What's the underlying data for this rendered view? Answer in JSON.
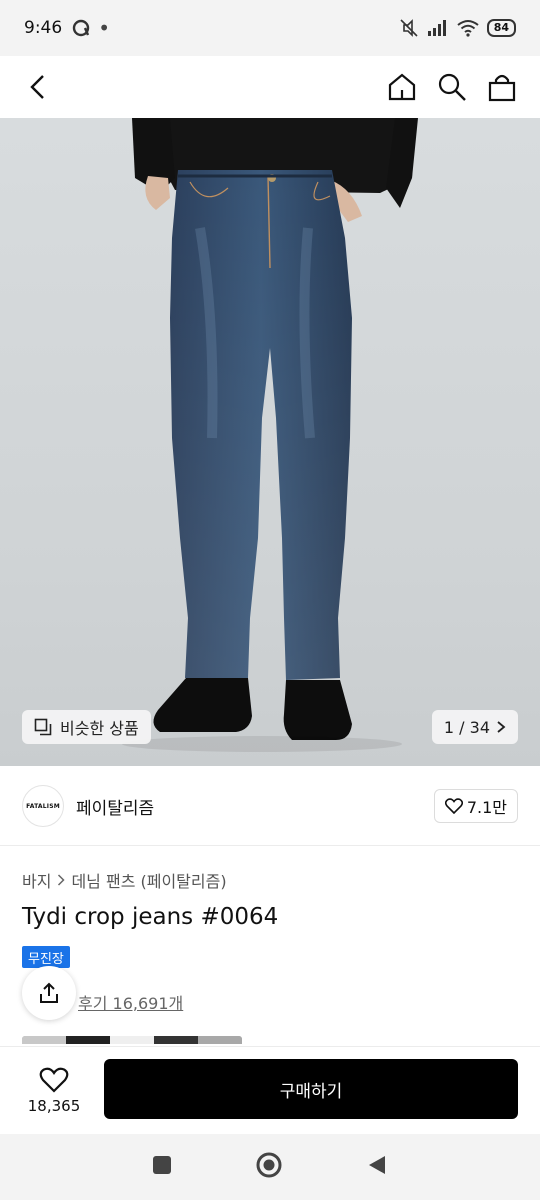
{
  "status": {
    "time": "9:46",
    "battery": "84"
  },
  "nav": {
    "icons": [
      "back-arrow-icon",
      "home-icon",
      "search-icon",
      "shopping-bag-icon"
    ]
  },
  "gallery": {
    "similar_label": "비슷한 상품",
    "pager": "1 / 34"
  },
  "brand": {
    "logo_text": "FATALISM",
    "name": "페이탈리즘",
    "likes": "7.1만"
  },
  "breadcrumb": {
    "category": "바지",
    "subcategory": "데님 팬츠 (페이탈리즘)"
  },
  "product": {
    "title": "Tydi crop jeans #0064",
    "badge": "무진장",
    "reviews": "후기 16,691개"
  },
  "bottom": {
    "wish_count": "18,365",
    "buy_label": "구매하기"
  },
  "colors": {
    "badge": "#1a73e8",
    "buy_button": "#000000"
  }
}
